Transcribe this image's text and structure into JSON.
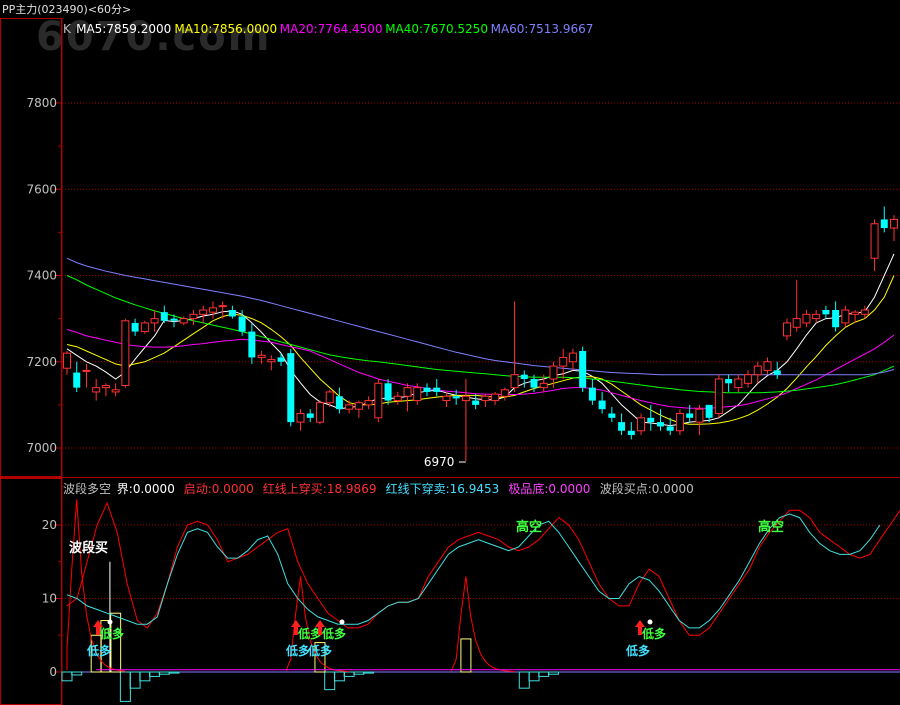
{
  "header": {
    "title": "PP主力(023490)<60分>",
    "watermark": "6070.com"
  },
  "colors": {
    "up": "#ff3232",
    "down": "#00ffff",
    "grid": "#a00000",
    "frame": "#b00000",
    "axis_text": "#c0c0c0",
    "ma5": "#ffffff",
    "ma10": "#ffff00",
    "ma20": "#ff00ff",
    "ma40": "#00ff00",
    "ma60": "#8080ff",
    "red_line": "#ff0000",
    "cyan_line": "#40e0e0",
    "yellow_bar": "#ffff80",
    "signal_green": "#40ff40",
    "signal_cyan": "#40e0ff"
  },
  "main_panel": {
    "legend": [
      {
        "text": "K",
        "color": "#c0c0c0"
      },
      {
        "text": "MA5:7859.2000",
        "color": "#ffffff"
      },
      {
        "text": "MA10:7856.0000",
        "color": "#ffff00"
      },
      {
        "text": "MA20:7764.4500",
        "color": "#ff00ff"
      },
      {
        "text": "MA40:7670.5250",
        "color": "#00ff00"
      },
      {
        "text": "MA60:7513.9667",
        "color": "#8080ff"
      }
    ],
    "y_ticks": [
      "7800",
      "7600",
      "7400",
      "7200",
      "7000"
    ],
    "low_marker": "6970"
  },
  "indicator_panel": {
    "legend": [
      {
        "text": "波段多空",
        "color": "#c0c0c0"
      },
      {
        "text": "界:0.0000",
        "color": "#ffffff"
      },
      {
        "text": "启动:0.0000",
        "color": "#ff3232"
      },
      {
        "text": "红线上穿买:18.9869",
        "color": "#ff3232"
      },
      {
        "text": "红线下穿卖:16.9453",
        "color": "#40e0ff"
      },
      {
        "text": "极品底:0.0000",
        "color": "#ff40ff"
      },
      {
        "text": "波段买点:0.0000",
        "color": "#c0c0c0"
      }
    ],
    "y_ticks": [
      "20",
      "10",
      "0"
    ],
    "labels": {
      "wave_buy": "波段买",
      "high_short_1": "高空",
      "high_short_2": "高空",
      "low_long": "低多"
    }
  },
  "chart_data": {
    "type": "candlestick",
    "title": "PP主力(023490)<60分>",
    "ylim": [
      6930,
      7900
    ],
    "ohlc": [
      [
        7185,
        7225,
        7170,
        7220
      ],
      [
        7175,
        7200,
        7130,
        7140
      ],
      [
        7180,
        7195,
        7140,
        7180
      ],
      [
        7130,
        7160,
        7110,
        7140
      ],
      [
        7140,
        7150,
        7120,
        7145
      ],
      [
        7130,
        7150,
        7120,
        7135
      ],
      [
        7145,
        7300,
        7140,
        7295
      ],
      [
        7290,
        7300,
        7260,
        7270
      ],
      [
        7270,
        7295,
        7265,
        7290
      ],
      [
        7290,
        7320,
        7270,
        7300
      ],
      [
        7315,
        7330,
        7290,
        7295
      ],
      [
        7300,
        7310,
        7280,
        7295
      ],
      [
        7290,
        7305,
        7285,
        7300
      ],
      [
        7300,
        7320,
        7285,
        7310
      ],
      [
        7310,
        7330,
        7290,
        7320
      ],
      [
        7315,
        7340,
        7300,
        7325
      ],
      [
        7330,
        7340,
        7300,
        7330
      ],
      [
        7320,
        7330,
        7300,
        7305
      ],
      [
        7305,
        7320,
        7260,
        7270
      ],
      [
        7270,
        7290,
        7195,
        7210
      ],
      [
        7210,
        7225,
        7195,
        7215
      ],
      [
        7200,
        7215,
        7180,
        7205
      ],
      [
        7210,
        7220,
        7190,
        7200
      ],
      [
        7220,
        7230,
        7050,
        7060
      ],
      [
        7060,
        7090,
        7040,
        7080
      ],
      [
        7080,
        7090,
        7060,
        7070
      ],
      [
        7060,
        7110,
        7055,
        7105
      ],
      [
        7105,
        7135,
        7095,
        7130
      ],
      [
        7120,
        7140,
        7080,
        7090
      ],
      [
        7090,
        7110,
        7080,
        7100
      ],
      [
        7090,
        7110,
        7070,
        7105
      ],
      [
        7100,
        7120,
        7090,
        7110
      ],
      [
        7070,
        7160,
        7060,
        7150
      ],
      [
        7150,
        7160,
        7100,
        7110
      ],
      [
        7110,
        7130,
        7100,
        7120
      ],
      [
        7120,
        7150,
        7085,
        7140
      ],
      [
        7110,
        7150,
        7100,
        7140
      ],
      [
        7140,
        7150,
        7120,
        7130
      ],
      [
        7140,
        7160,
        7120,
        7130
      ],
      [
        7110,
        7130,
        7095,
        7120
      ],
      [
        7120,
        7135,
        7100,
        7115
      ],
      [
        7110,
        7160,
        6970,
        7120
      ],
      [
        7110,
        7125,
        7090,
        7100
      ],
      [
        7110,
        7125,
        7095,
        7120
      ],
      [
        7110,
        7130,
        7100,
        7125
      ],
      [
        7120,
        7140,
        7110,
        7135
      ],
      [
        7140,
        7340,
        7130,
        7170
      ],
      [
        7170,
        7180,
        7140,
        7160
      ],
      [
        7160,
        7170,
        7130,
        7140
      ],
      [
        7140,
        7170,
        7130,
        7150
      ],
      [
        7160,
        7200,
        7140,
        7190
      ],
      [
        7190,
        7230,
        7160,
        7210
      ],
      [
        7200,
        7230,
        7180,
        7220
      ],
      [
        7225,
        7235,
        7130,
        7140
      ],
      [
        7140,
        7160,
        7100,
        7110
      ],
      [
        7110,
        7130,
        7080,
        7090
      ],
      [
        7080,
        7095,
        7060,
        7070
      ],
      [
        7060,
        7080,
        7030,
        7040
      ],
      [
        7040,
        7060,
        7020,
        7030
      ],
      [
        7040,
        7080,
        7030,
        7070
      ],
      [
        7070,
        7100,
        7040,
        7060
      ],
      [
        7060,
        7090,
        7040,
        7050
      ],
      [
        7050,
        7070,
        7030,
        7040
      ],
      [
        7040,
        7090,
        7030,
        7080
      ],
      [
        7080,
        7100,
        7060,
        7070
      ],
      [
        7060,
        7100,
        7030,
        7090
      ],
      [
        7100,
        7100,
        7060,
        7070
      ],
      [
        7080,
        7170,
        7070,
        7160
      ],
      [
        7160,
        7170,
        7130,
        7150
      ],
      [
        7140,
        7170,
        7130,
        7160
      ],
      [
        7150,
        7180,
        7140,
        7170
      ],
      [
        7170,
        7200,
        7150,
        7190
      ],
      [
        7180,
        7210,
        7170,
        7200
      ],
      [
        7180,
        7200,
        7160,
        7170
      ],
      [
        7260,
        7300,
        7250,
        7290
      ],
      [
        7280,
        7390,
        7270,
        7300
      ],
      [
        7290,
        7320,
        7280,
        7310
      ],
      [
        7300,
        7320,
        7290,
        7310
      ],
      [
        7320,
        7330,
        7300,
        7310
      ],
      [
        7320,
        7340,
        7270,
        7280
      ],
      [
        7290,
        7330,
        7280,
        7320
      ],
      [
        7310,
        7320,
        7290,
        7315
      ],
      [
        7310,
        7330,
        7300,
        7320
      ],
      [
        7440,
        7530,
        7410,
        7520
      ],
      [
        7530,
        7560,
        7500,
        7510
      ],
      [
        7510,
        7540,
        7480,
        7530
      ]
    ],
    "series": [
      {
        "name": "MA5",
        "values": [
          7230,
          7215,
          7200,
          7190,
          7176,
          7160,
          7176,
          7206,
          7233,
          7260,
          7296,
          7293,
          7296,
          7300,
          7306,
          7310,
          7316,
          7318,
          7310,
          7290,
          7268,
          7243,
          7220,
          7180,
          7151,
          7124,
          7107,
          7100,
          7091,
          7094,
          7097,
          7106,
          7115,
          7115,
          7116,
          7120,
          7128,
          7132,
          7134,
          7128,
          7122,
          7118,
          7114,
          7112,
          7112,
          7118,
          7140,
          7150,
          7156,
          7160,
          7168,
          7172,
          7180,
          7178,
          7166,
          7150,
          7125,
          7100,
          7080,
          7060,
          7058,
          7055,
          7052,
          7055,
          7060,
          7062,
          7064,
          7070,
          7085,
          7100,
          7125,
          7150,
          7168,
          7180,
          7200,
          7230,
          7262,
          7290,
          7300,
          7302,
          7310,
          7312,
          7316,
          7350,
          7400,
          7450
        ]
      },
      {
        "name": "MA10",
        "values": [
          7240,
          7235,
          7225,
          7215,
          7205,
          7195,
          7190,
          7195,
          7200,
          7210,
          7220,
          7235,
          7250,
          7265,
          7280,
          7295,
          7305,
          7310,
          7308,
          7300,
          7290,
          7275,
          7258,
          7238,
          7210,
          7185,
          7160,
          7140,
          7120,
          7105,
          7100,
          7100,
          7102,
          7106,
          7108,
          7110,
          7112,
          7115,
          7118,
          7120,
          7122,
          7122,
          7122,
          7120,
          7118,
          7118,
          7122,
          7130,
          7138,
          7144,
          7150,
          7156,
          7162,
          7165,
          7165,
          7160,
          7148,
          7132,
          7116,
          7100,
          7088,
          7076,
          7066,
          7058,
          7055,
          7055,
          7056,
          7058,
          7062,
          7068,
          7076,
          7088,
          7102,
          7118,
          7138,
          7162,
          7188,
          7212,
          7238,
          7260,
          7280,
          7292,
          7300,
          7320,
          7350,
          7400
        ]
      },
      {
        "name": "MA20",
        "values": [
          7275,
          7268,
          7260,
          7255,
          7250,
          7245,
          7240,
          7237,
          7235,
          7234,
          7234,
          7235,
          7237,
          7240,
          7242,
          7245,
          7248,
          7250,
          7252,
          7250,
          7248,
          7245,
          7240,
          7235,
          7230,
          7225,
          7215,
          7205,
          7195,
          7185,
          7175,
          7168,
          7160,
          7155,
          7150,
          7145,
          7142,
          7138,
          7135,
          7132,
          7130,
          7128,
          7126,
          7125,
          7124,
          7124,
          7124,
          7125,
          7127,
          7130,
          7134,
          7138,
          7140,
          7140,
          7138,
          7134,
          7128,
          7122,
          7116,
          7110,
          7105,
          7100,
          7096,
          7094,
          7092,
          7092,
          7092,
          7094,
          7096,
          7098,
          7102,
          7108,
          7114,
          7120,
          7128,
          7138,
          7148,
          7158,
          7170,
          7182,
          7194,
          7206,
          7218,
          7230,
          7245,
          7262
        ]
      },
      {
        "name": "MA40",
        "values": [
          7400,
          7390,
          7378,
          7368,
          7358,
          7348,
          7340,
          7332,
          7325,
          7318,
          7312,
          7306,
          7300,
          7295,
          7290,
          7285,
          7280,
          7275,
          7270,
          7264,
          7258,
          7252,
          7246,
          7240,
          7234,
          7228,
          7222,
          7216,
          7212,
          7208,
          7205,
          7202,
          7200,
          7197,
          7194,
          7191,
          7188,
          7185,
          7182,
          7180,
          7178,
          7176,
          7174,
          7172,
          7170,
          7168,
          7166,
          7165,
          7164,
          7164,
          7164,
          7164,
          7163,
          7162,
          7160,
          7158,
          7155,
          7152,
          7149,
          7146,
          7143,
          7140,
          7138,
          7135,
          7133,
          7131,
          7130,
          7129,
          7128,
          7128,
          7128,
          7128,
          7129,
          7130,
          7132,
          7134,
          7137,
          7140,
          7143,
          7147,
          7152,
          7158,
          7164,
          7170,
          7180,
          7190
        ]
      },
      {
        "name": "MA60",
        "values": [
          7440,
          7430,
          7422,
          7416,
          7410,
          7405,
          7400,
          7396,
          7392,
          7388,
          7384,
          7380,
          7376,
          7372,
          7368,
          7364,
          7360,
          7356,
          7352,
          7347,
          7342,
          7336,
          7330,
          7324,
          7318,
          7312,
          7306,
          7300,
          7294,
          7288,
          7282,
          7276,
          7270,
          7264,
          7258,
          7252,
          7246,
          7240,
          7234,
          7228,
          7222,
          7217,
          7212,
          7207,
          7203,
          7200,
          7197,
          7194,
          7191,
          7189,
          7187,
          7185,
          7183,
          7181,
          7179,
          7177,
          7175,
          7174,
          7173,
          7172,
          7171,
          7170,
          7170,
          7170,
          7170,
          7170,
          7170,
          7170,
          7170,
          7170,
          7170,
          7170,
          7170,
          7170,
          7170,
          7170,
          7170,
          7170,
          7170,
          7170,
          7170,
          7170,
          7170,
          7172,
          7176,
          7182
        ]
      }
    ],
    "indicator": {
      "ylim": [
        -4,
        25
      ],
      "red_line": [
        9,
        10,
        15,
        20,
        23,
        19,
        12,
        7,
        6,
        8,
        12,
        17,
        20,
        20.5,
        20,
        18,
        15,
        15.5,
        16,
        17,
        18,
        19,
        19.5,
        15,
        12,
        10,
        8,
        7,
        6,
        6,
        6.5,
        8,
        9,
        9.5,
        9.5,
        10,
        13,
        15,
        17,
        18,
        18.5,
        19,
        18.5,
        18,
        17,
        16.5,
        17,
        18,
        19.5,
        21,
        20,
        18,
        15,
        12,
        10,
        9,
        9,
        12,
        14,
        13,
        10,
        7,
        5,
        5,
        6,
        8,
        10,
        12,
        14,
        17,
        19,
        20.5,
        22,
        22,
        21,
        19,
        18,
        17,
        16,
        15.5,
        16,
        18,
        20,
        22
      ],
      "cyan_line": [
        10.5,
        10,
        9,
        8.5,
        8,
        7.5,
        7,
        6.5,
        6.5,
        7.5,
        12,
        16,
        19,
        19.5,
        19,
        17,
        15.5,
        15.5,
        16.5,
        18,
        18.5,
        16,
        12,
        10,
        8.5,
        7.5,
        7,
        6.5,
        6.5,
        6.5,
        7,
        8,
        9,
        9.5,
        9.5,
        10,
        12,
        14,
        16,
        17,
        17.5,
        18,
        17.5,
        17,
        16.5,
        17,
        18.5,
        20,
        20.5,
        19,
        17,
        15,
        13,
        11,
        10,
        10,
        12,
        13,
        12.5,
        11,
        9,
        7,
        6,
        6,
        7,
        8.5,
        10.5,
        12.5,
        15,
        17.5,
        19.5,
        21,
        21.5,
        21,
        19,
        17.5,
        16.5,
        16,
        16,
        16.5,
        18,
        20
      ]
    }
  }
}
